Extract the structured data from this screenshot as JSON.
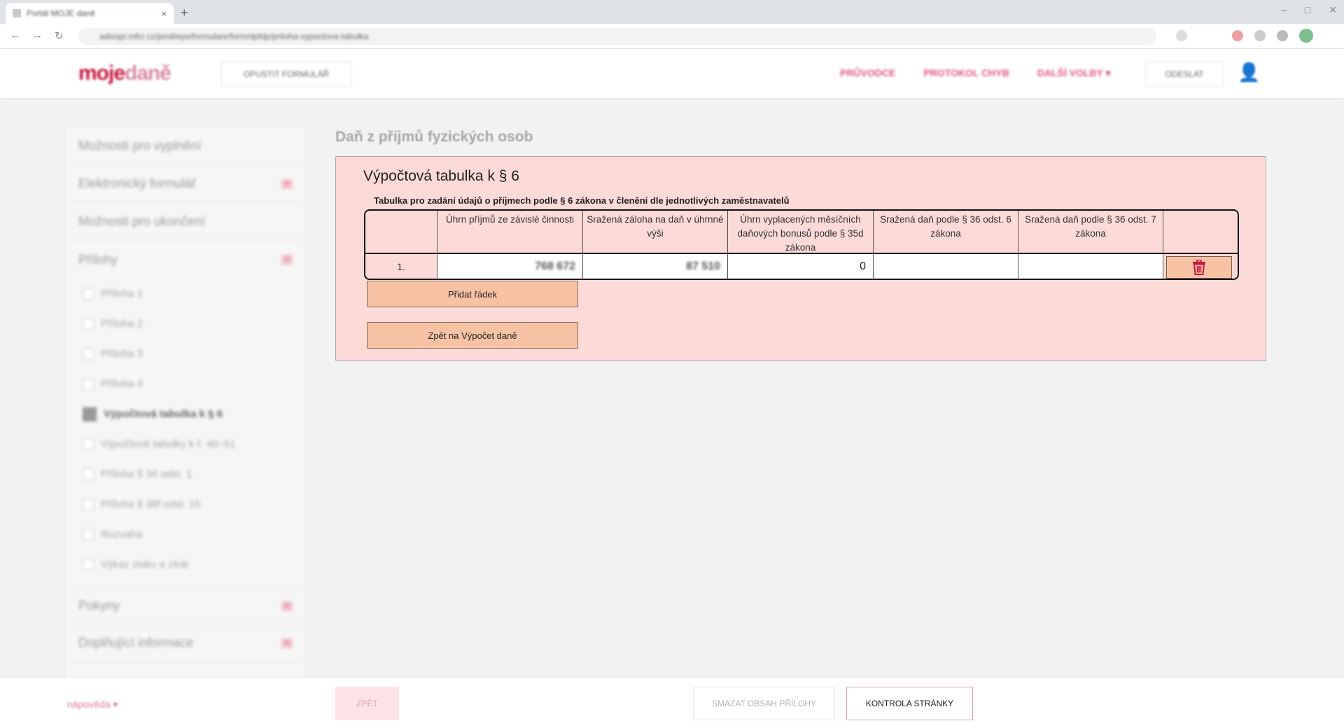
{
  "browser": {
    "tab_title": "Portál MOJE daně",
    "tab_close": "×",
    "new_tab": "+",
    "url": "adisspr.mfcr.cz/pmd/epo/formulare/form/dpfdp/priloha-vypoctova-tabulka",
    "back_icon": "←",
    "forward_icon": "→",
    "reload_icon": "↻"
  },
  "header": {
    "logo_a": "moje",
    "logo_b": "daně",
    "left_button": "OPUSTIT FORMULÁŘ",
    "links": [
      "PRŮVODCE",
      "PROTOKOL CHYB",
      "DALŠÍ VOLBY ▾"
    ],
    "right_button": "ODESLAT",
    "user_icon": "👤"
  },
  "sidebar": {
    "sections_top": [
      {
        "label": "Možnosti pro vyplnění",
        "mark": false
      },
      {
        "label": "Elektronický formulář",
        "mark": true
      },
      {
        "label": "Možnosti pro ukončení",
        "mark": false
      },
      {
        "label": "Přílohy",
        "mark": true
      }
    ],
    "attachments": [
      {
        "label": "Příloha 1"
      },
      {
        "label": "Příloha 2"
      },
      {
        "label": "Příloha 3"
      },
      {
        "label": "Příloha 4"
      },
      {
        "label": "Výpočtová tabulka k § 6"
      },
      {
        "label": "Výpočtové tabulky k ř. 40–51"
      },
      {
        "label": "Příloha § 34 odst. 1"
      },
      {
        "label": "Příloha § 38f odst. 15"
      },
      {
        "label": "Rozvaha"
      },
      {
        "label": "Výkaz zisku a ztrát"
      }
    ],
    "sections_bottom": [
      {
        "label": "Pokyny",
        "mark": true
      },
      {
        "label": "Doplňující informace",
        "mark": true
      }
    ],
    "mark_symbol": "×"
  },
  "page": {
    "title": "Daň z příjmů fyzických osob"
  },
  "panel": {
    "heading": "Výpočtová tabulka k § 6",
    "subheading": "Tabulka pro zadání údajů o příjmech podle § 6 zákona v členění dle jednotlivých zaměstnavatelů",
    "columns": [
      "",
      "Úhrn příjmů ze závislé činnosti",
      "Sražená záloha na daň v úhrnné výši",
      "Úhrn vyplacených měsíčních daňových bonusů podle § 35d zákona",
      "Sražená daň podle § 36 odst. 6 zákona",
      "Sražená daň podle § 36 odst. 7 zákona",
      ""
    ],
    "rows": [
      {
        "num": "1.",
        "income": "768 672",
        "advance": "87 510",
        "bonus": "0",
        "tax6": "",
        "tax7": ""
      }
    ],
    "add_row_label": "Přidat řádek",
    "back_to_calc_label": "Zpět na Výpočet daně"
  },
  "footer": {
    "help_label": "nápověda ▾",
    "back_label": "ZPĚT",
    "clear_label": "SMAZAT OBSAH PŘÍLOHY",
    "check_label": "KONTROLA STRÁNKY"
  },
  "colors": {
    "accent": "#c8163f",
    "panel_bg": "#fcdad7",
    "button_bg": "#f8c3a5",
    "trash": "#c8163f"
  }
}
